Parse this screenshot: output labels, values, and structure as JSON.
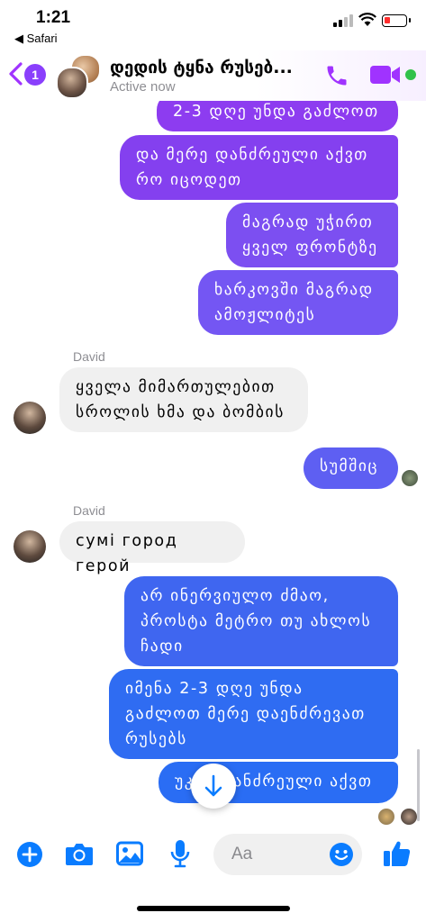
{
  "status_bar": {
    "time": "1:21",
    "back_app": "◀ Safari"
  },
  "header": {
    "back_badge_count": "1",
    "chat_name": "დედის ტყნა რუსებ...",
    "status": "Active now",
    "accent_color": "#a033ff",
    "online_color": "#31c24a"
  },
  "messages": [
    {
      "direction": "outgoing",
      "text": "2-3 დღე უნდა გაძლოთ",
      "color": "#8d3cf0"
    },
    {
      "direction": "outgoing",
      "text": "და მერე დანძრეული აქვთ რო იცოდეთ",
      "color": "#8440ef"
    },
    {
      "direction": "outgoing",
      "text": "მაგრად უჭირთ ყველ ფრონტზე",
      "color": "#7c4ff1"
    },
    {
      "direction": "outgoing",
      "text": "ხარკოვში მაგრად ამოჟლიტეს",
      "color": "#7456f3"
    },
    {
      "direction": "incoming",
      "sender": "David",
      "text": "ყველა მიმართულებით სროლის ხმა და ბომბის"
    },
    {
      "direction": "outgoing",
      "text": "სუმშიც",
      "color": "#5e5ff2"
    },
    {
      "direction": "incoming",
      "sender": "David",
      "text": "сумі город герой"
    },
    {
      "direction": "outgoing",
      "text": "არ ინერვიულო ძმაო, პროსტა მეტრო თუ ახლოს ჩადი",
      "color": "#3f66f0"
    },
    {
      "direction": "outgoing",
      "text": "იმენა 2-3 დღე უნდა გაძლოთ მერე დაენძრევათ რუსებს",
      "color": "#2f6cf2"
    },
    {
      "direction": "outgoing",
      "text": "უკვე დანძრეული აქვთ",
      "color": "#2a6df4"
    }
  ],
  "composer": {
    "placeholder": "Aa",
    "icon_color": "#0a7cff",
    "icons": [
      "plus-icon",
      "camera-icon",
      "image-icon",
      "microphone-icon",
      "emoji-icon",
      "thumbs-up-icon"
    ]
  }
}
